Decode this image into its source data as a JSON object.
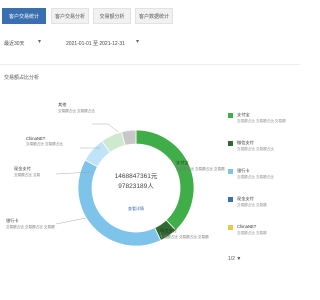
{
  "tabs": [
    {
      "label": "客户交易统计",
      "active": true
    },
    {
      "label": "客户交易分析",
      "active": false
    },
    {
      "label": "交易额分析",
      "active": false
    },
    {
      "label": "客户数据统计",
      "active": false
    }
  ],
  "filters": {
    "range_label": "最近30天",
    "date_range": "2021-01-01 至 2021-12-31"
  },
  "section_title": "交易额占比分析",
  "chart_center": {
    "amount": "1468847361元",
    "count": "97823189人",
    "link": "查看详情"
  },
  "chart_data": {
    "type": "pie",
    "categories": [
      "支付宝",
      "微信支付",
      "银行卡",
      "现金支付",
      "ChinaNET",
      "其他"
    ],
    "values": [
      38,
      5,
      40,
      7,
      6,
      4
    ],
    "colors": [
      "#3fae49",
      "#2e6b2e",
      "#7ec3ea",
      "#bfe3f7",
      "#cfe9cf",
      "#c8c8c8"
    ]
  },
  "callouts": [
    {
      "name": "其他",
      "detail": "交易额占比 交易额占比"
    },
    {
      "name": "ChinaNET",
      "detail": "交易额占比 交易额占比"
    },
    {
      "name": "现金支付",
      "detail": "交易额占比 交易"
    },
    {
      "name": "支付宝",
      "detail": "交易额占比 交易额占比 交易额"
    },
    {
      "name": "银行卡",
      "detail": "交易额占比 交易额占比 交易额"
    },
    {
      "name": "微信支付",
      "detail": "交易额占比 交易额占比 交易额"
    }
  ],
  "legend": [
    {
      "name": "支付宝",
      "detail": "交易额占比 交易额占比 交易额",
      "color": "#3fae49"
    },
    {
      "name": "微信支付",
      "detail": "交易额占比 交易额占比",
      "color": "#2e6b2e"
    },
    {
      "name": "银行卡",
      "detail": "交易额占比 交易额占比",
      "color": "#7ec3ea"
    },
    {
      "name": "现金支付",
      "detail": "交易额占比 交易额",
      "color": "#3a6fb0"
    },
    {
      "name": "ChinaNET",
      "detail": "交易额占比 交易额",
      "color": "#e8c84a"
    }
  ],
  "legend_more": "1/2 ▼"
}
